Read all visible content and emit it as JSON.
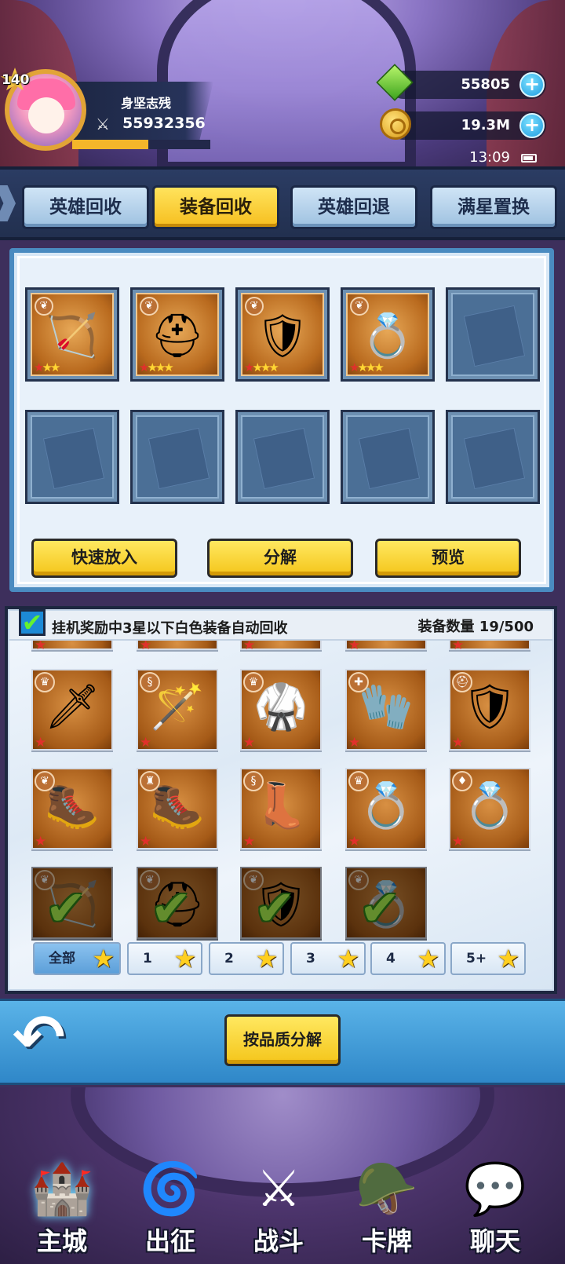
{
  "player": {
    "level": "140",
    "name": "身坚志残",
    "power": "55932356",
    "exp_fraction": 0.55
  },
  "currencies": {
    "gems": "55805",
    "gold": "19.3M",
    "plus": "+"
  },
  "status": {
    "time": "13:09"
  },
  "tabs": [
    {
      "label": "英雄回收",
      "active": false
    },
    {
      "label": "装备回收",
      "active": true
    },
    {
      "label": "英雄回退",
      "active": false
    },
    {
      "label": "满星置换",
      "active": false
    }
  ],
  "selected_slots": [
    {
      "item": "bow-icon",
      "glyph": "🏹",
      "stars": 3
    },
    {
      "item": "helmet-icon",
      "glyph": "⛑",
      "stars": 4
    },
    {
      "item": "shield-icon",
      "glyph": "🛡",
      "stars": 4
    },
    {
      "item": "ring-icon",
      "glyph": "💍",
      "stars": 4
    }
  ],
  "actions": {
    "quick_add": "快速放入",
    "decompose": "分解",
    "preview": "预览",
    "decompose_by_quality": "按品质分解"
  },
  "inventory": {
    "auto_recycle_label": "挂机奖励中3星以下白色装备自动回收",
    "auto_recycle_checked": true,
    "count_label": "装备数量",
    "count_value": "19/500",
    "rows": [
      [
        {
          "name": "sword-icon",
          "glyph": "🗡",
          "badge": "♛"
        },
        {
          "name": "staff-icon",
          "glyph": "🪄",
          "badge": "§"
        },
        {
          "name": "armor-icon",
          "glyph": "🥋",
          "badge": "♛"
        },
        {
          "name": "gloves-icon",
          "glyph": "🧤",
          "badge": "✚"
        },
        {
          "name": "shield-icon",
          "glyph": "🛡",
          "badge": "⛑"
        }
      ],
      [
        {
          "name": "boots-icon",
          "glyph": "🥾",
          "badge": "❦"
        },
        {
          "name": "iron-boots-icon",
          "glyph": "🥾",
          "badge": "♜"
        },
        {
          "name": "winged-boots-icon",
          "glyph": "👢",
          "badge": "§"
        },
        {
          "name": "purple-ring-icon",
          "glyph": "💍",
          "badge": "♛"
        },
        {
          "name": "blue-ring-icon",
          "glyph": "💍",
          "badge": "♦"
        }
      ],
      [
        {
          "name": "bow-icon",
          "glyph": "🏹",
          "badge": "❦",
          "checked": true
        },
        {
          "name": "helmet-icon",
          "glyph": "⛑",
          "badge": "❦",
          "checked": true
        },
        {
          "name": "shield-icon",
          "glyph": "🛡",
          "badge": "❦",
          "checked": true
        },
        {
          "name": "ring-icon",
          "glyph": "💍",
          "badge": "❦",
          "checked": true
        }
      ]
    ]
  },
  "star_filters": [
    {
      "label": "全部",
      "active": true
    },
    {
      "label": "1",
      "active": false
    },
    {
      "label": "2",
      "active": false
    },
    {
      "label": "3",
      "active": false
    },
    {
      "label": "4",
      "active": false
    },
    {
      "label": "5+",
      "active": false
    }
  ],
  "bottom_nav": [
    {
      "label": "主城",
      "icon": "castle-icon",
      "glyph": "🏰",
      "active": true
    },
    {
      "label": "出征",
      "icon": "portal-icon",
      "glyph": "🌀",
      "active": false
    },
    {
      "label": "战斗",
      "icon": "crossed-swords-icon",
      "glyph": "⚔",
      "active": false
    },
    {
      "label": "卡牌",
      "icon": "helmet-card-icon",
      "glyph": "🪖",
      "active": false
    },
    {
      "label": "聊天",
      "icon": "chat-bubble-icon",
      "glyph": "💬",
      "active": false
    }
  ]
}
